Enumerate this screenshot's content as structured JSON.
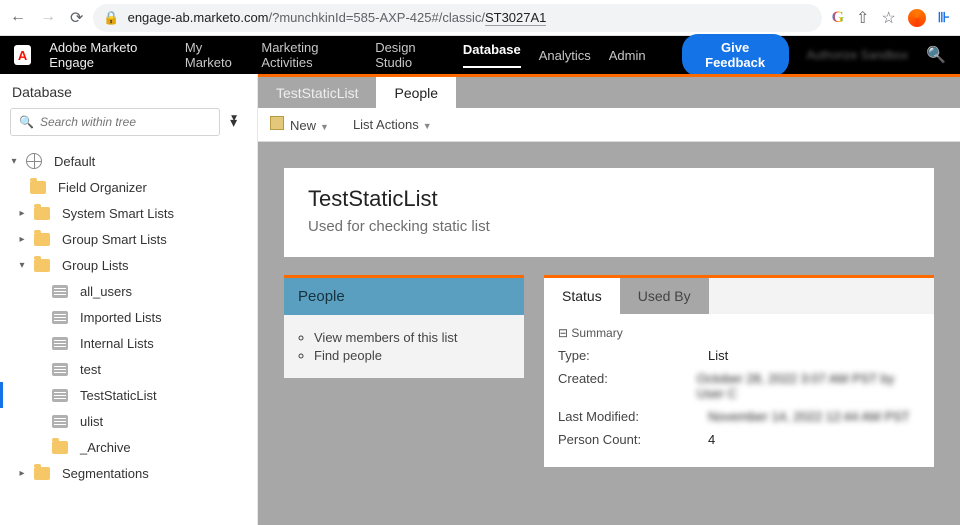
{
  "browser": {
    "url_host": "engage-ab.marketo.com",
    "url_path": "/?munchkinId=585-AXP-425#/classic/",
    "url_segment": "ST3027A1"
  },
  "appbar": {
    "product": "Adobe Marketo Engage",
    "nav": [
      "My Marketo",
      "Marketing Activities",
      "Design Studio",
      "Database",
      "Analytics",
      "Admin"
    ],
    "active_index": 3,
    "feedback": "Give Feedback",
    "user_blur": "Authorize Sandbox"
  },
  "sidebar": {
    "title": "Database",
    "search_placeholder": "Search within tree",
    "root": "Default",
    "children": [
      {
        "label": "Field Organizer",
        "icon": "folder",
        "depth": 1
      },
      {
        "label": "System Smart Lists",
        "icon": "folder",
        "depth": 1,
        "caret": "right"
      },
      {
        "label": "Group Smart Lists",
        "icon": "folder",
        "depth": 1,
        "caret": "right"
      },
      {
        "label": "Group Lists",
        "icon": "folder",
        "depth": 1,
        "caret": "down"
      },
      {
        "label": "all_users",
        "icon": "list",
        "depth": 2
      },
      {
        "label": "Imported Lists",
        "icon": "list",
        "depth": 2
      },
      {
        "label": "Internal Lists",
        "icon": "list",
        "depth": 2
      },
      {
        "label": "test",
        "icon": "list",
        "depth": 2
      },
      {
        "label": "TestStaticList",
        "icon": "list",
        "depth": 2,
        "selected": true
      },
      {
        "label": "ulist",
        "icon": "list",
        "depth": 2
      },
      {
        "label": "_Archive",
        "icon": "folder",
        "depth": 2
      },
      {
        "label": "Segmentations",
        "icon": "folder",
        "depth": 1,
        "caret": "right"
      }
    ]
  },
  "main": {
    "breadcrumb": [
      "TestStaticList",
      "People"
    ],
    "toolbar": {
      "new": "New",
      "list_actions": "List Actions"
    },
    "title": "TestStaticList",
    "desc": "Used for checking static list"
  },
  "people_panel": {
    "head": "People",
    "links": [
      "View members of this list",
      "Find people"
    ]
  },
  "status_panel": {
    "tabs": [
      "Status",
      "Used By"
    ],
    "active_tab": 0,
    "summary": "Summary",
    "rows": [
      {
        "k": "Type:",
        "v": "List"
      },
      {
        "k": "Created:",
        "v": "October 28, 2022 3:07 AM PST by User C",
        "blur": true
      },
      {
        "k": "Last Modified:",
        "v": "November 14, 2022 12:44 AM PST",
        "blur": true
      },
      {
        "k": "Person Count:",
        "v": "4"
      }
    ]
  }
}
